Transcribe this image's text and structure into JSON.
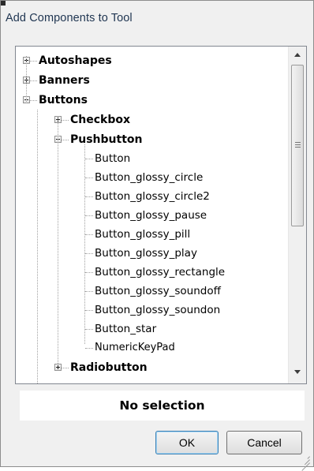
{
  "dialog": {
    "title": "Add Components to Tool"
  },
  "tree": {
    "items": [
      {
        "label": "Autoshapes",
        "bold": true,
        "expander": "plus"
      },
      {
        "label": "Banners",
        "bold": true,
        "expander": "plus"
      },
      {
        "label": "Buttons",
        "bold": true,
        "expander": "minus"
      },
      {
        "label": "Checkbox",
        "bold": true,
        "expander": "plus"
      },
      {
        "label": "Pushbutton",
        "bold": true,
        "expander": "minus"
      },
      {
        "label": "Button",
        "bold": false,
        "expander": "none"
      },
      {
        "label": "Button_glossy_circle",
        "bold": false,
        "expander": "none"
      },
      {
        "label": "Button_glossy_circle2",
        "bold": false,
        "expander": "none"
      },
      {
        "label": "Button_glossy_pause",
        "bold": false,
        "expander": "none"
      },
      {
        "label": "Button_glossy_pill",
        "bold": false,
        "expander": "none"
      },
      {
        "label": "Button_glossy_play",
        "bold": false,
        "expander": "none"
      },
      {
        "label": "Button_glossy_rectangle",
        "bold": false,
        "expander": "none"
      },
      {
        "label": "Button_glossy_soundoff",
        "bold": false,
        "expander": "none"
      },
      {
        "label": "Button_glossy_soundon",
        "bold": false,
        "expander": "none"
      },
      {
        "label": "Button_star",
        "bold": false,
        "expander": "none"
      },
      {
        "label": "NumericKeyPad",
        "bold": false,
        "expander": "none"
      },
      {
        "label": "Radiobutton",
        "bold": true,
        "expander": "plus"
      }
    ]
  },
  "scrollbar": {
    "up_icon": "arrow-up-icon",
    "down_icon": "arrow-down-icon"
  },
  "status": {
    "text": "No selection"
  },
  "buttons": {
    "ok_label": "OK",
    "cancel_label": "Cancel"
  },
  "colors": {
    "title_text": "#1f3551",
    "ok_border": "#3c7fb1"
  }
}
